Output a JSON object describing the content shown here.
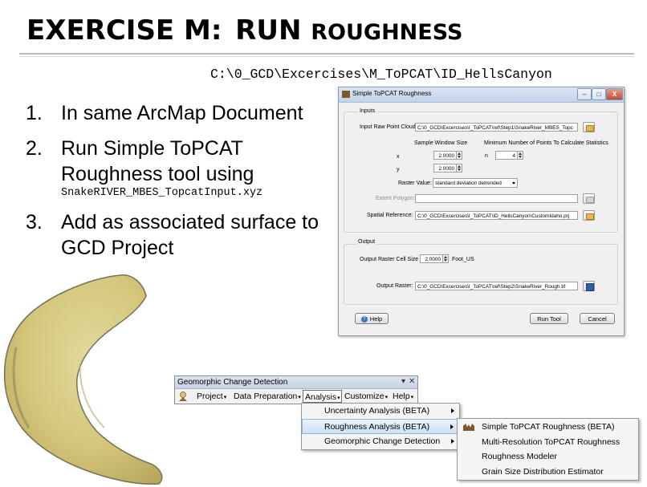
{
  "slide": {
    "title_part1": "EXERCISE M:",
    "title_part2_big": "RUN ",
    "title_part2_small": "ROUGHNESS",
    "path": "C:\\0_GCD\\Excercises\\M_ToPCAT\\ID_HellsCanyon",
    "steps": [
      {
        "num": "1.",
        "text": "In same ArcMap Document"
      },
      {
        "num": "2.",
        "text": "Run Simple ToPCAT Roughness tool using",
        "mono": "SnakeRIVER_MBES_TopcatInput.xyz"
      },
      {
        "num": "3.",
        "text": "Add as associated surface to GCD Project"
      }
    ]
  },
  "dialog": {
    "title": "Simple ToPCAT Roughness",
    "min": "–",
    "max": "□",
    "close": "X",
    "inputs_group": "Inputs",
    "raw_point_label": "Input Raw Point Cloud:",
    "raw_point_value": "C:\\0_GCD\\Excercises\\I_ToPCAT\\ref\\Step1\\SnakeRiver_MBES_Topc",
    "sample_window_label": "Sample Window Size",
    "min_points_label": "Minimum Number of Points To Calculate Statistics",
    "x_label": "x",
    "x_value": "2.0000",
    "y_label": "y",
    "y_value": "2.0000",
    "n_label": "n",
    "n_value": "4",
    "raster_value_label": "Raster Value:",
    "raster_value_option": "standard deviation detrended",
    "extent_label": "Extent Polygon:",
    "extent_value": "",
    "spatial_ref_label": "Spatial Reference:",
    "spatial_ref_value": "C:\\0_GCD\\Excercises\\I_ToPCAT\\ID_HellsCanyon\\CustomIdaho.prj",
    "output_group": "Output",
    "cell_size_label": "Output Raster Cell Size",
    "cell_size_value": "2.0000",
    "cell_size_unit": "Foot_US",
    "output_raster_label": "Output Raster:",
    "output_raster_value": "C:\\0_GCD\\Excercises\\I_ToPCAT\\ref\\Step2\\SnakeRiver_Rough.tif",
    "help_button": "Help",
    "help_glyph": "?",
    "run_button": "Run Tool",
    "cancel_button": "Cancel"
  },
  "toolbar": {
    "title": "Geomorphic Change Detection",
    "dropdown_glyph": "▾",
    "close_glyph": "✕",
    "menus": [
      "Project",
      "Data Preparation",
      "Analysis",
      "Customize",
      "Help"
    ]
  },
  "analysis_menu": {
    "items": [
      "Uncertainty Analysis (BETA)",
      "Roughness Analysis (BETA)",
      "Geomorphic Change Detection"
    ]
  },
  "roughness_menu": {
    "items": [
      "Simple ToPCAT Roughness (BETA)",
      "Multi-Resolution ToPCAT Roughness",
      "Roughness Modeler",
      "Grain Size Distribution Estimator"
    ]
  },
  "colors": {
    "terrain_light": "#e9dd96",
    "terrain_mid": "#d6c46a",
    "terrain_shadow": "#6d6a52"
  }
}
